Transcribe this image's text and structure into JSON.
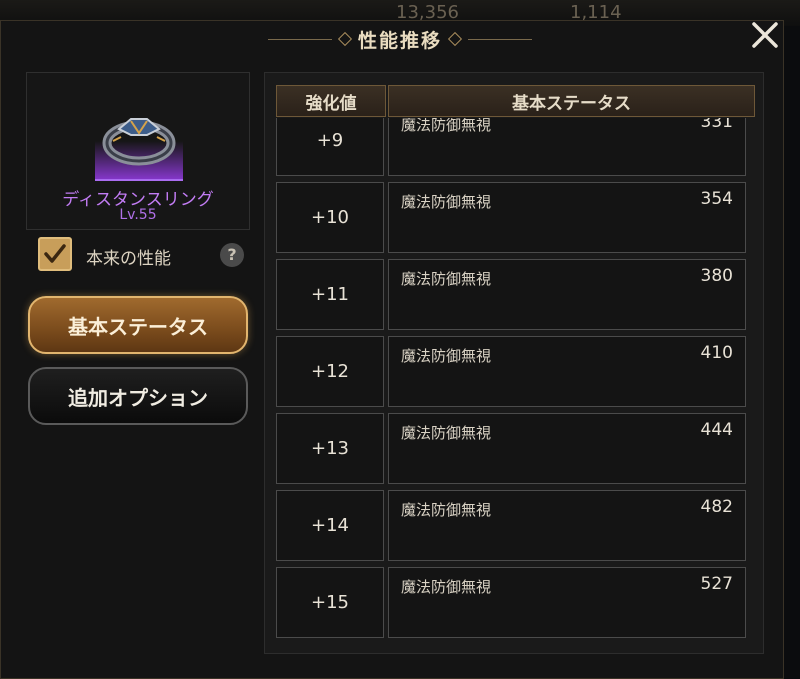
{
  "background": {
    "top_left_partial": "",
    "resource_1": "13,356",
    "resource_2": "1,114"
  },
  "dialog": {
    "title": "性能推移",
    "close_icon": "close-icon"
  },
  "item": {
    "name": "ディスタンスリング",
    "level": "Lv.55",
    "icon": "ring-icon",
    "rarity_color": "#a96cf0"
  },
  "options": {
    "original_performance_label": "本来の性能",
    "original_performance_checked": true,
    "help_icon_text": "?"
  },
  "tabs": {
    "basic_status": "基本ステータス",
    "additional_options": "追加オプション",
    "active": "basic_status"
  },
  "table": {
    "header_level": "強化値",
    "header_stat": "基本ステータス",
    "rows": [
      {
        "level": "+9",
        "stat": "魔法防御無視",
        "value": "331"
      },
      {
        "level": "+10",
        "stat": "魔法防御無視",
        "value": "354"
      },
      {
        "level": "+11",
        "stat": "魔法防御無視",
        "value": "380"
      },
      {
        "level": "+12",
        "stat": "魔法防御無視",
        "value": "410"
      },
      {
        "level": "+13",
        "stat": "魔法防御無視",
        "value": "444"
      },
      {
        "level": "+14",
        "stat": "魔法防御無視",
        "value": "482"
      },
      {
        "level": "+15",
        "stat": "魔法防御無視",
        "value": "527"
      }
    ]
  },
  "colors": {
    "accent_gold": "#c89e5a",
    "rarity_purple": "#c27cf4"
  }
}
